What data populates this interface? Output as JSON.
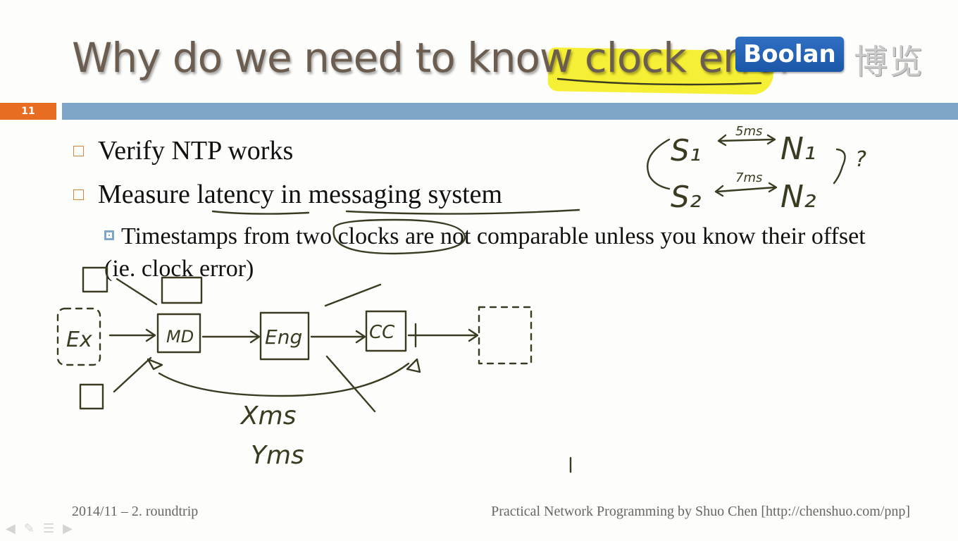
{
  "slide": {
    "title": "Why do we need to know clock error",
    "number": "11",
    "logo_text": "Boolan",
    "logo_cn": "博览"
  },
  "bullets": [
    "Verify NTP works",
    "Measure latency in messaging system"
  ],
  "sub_bullets": [
    "Timestamps from two clocks are not comparable unless you know their offset (ie. clock error)"
  ],
  "footer": {
    "left": "2014/11 – 2. roundtrip",
    "right": "Practical Network Programming by Shuo Chen [http://chenshuo.com/pnp]"
  },
  "annotations": {
    "s1": "S₁",
    "s2": "S₂",
    "n1": "N₁",
    "n2": "N₂",
    "t1": "5ms",
    "t2": "7ms",
    "q": "?",
    "exch": "Ex",
    "md": "MD",
    "eng": "Eng",
    "cc": "CC",
    "x": "Xms",
    "y": "Yms"
  },
  "colors": {
    "accent": "#e86c21",
    "bar": "#7fa6c8",
    "highlight": "#f4ee2a",
    "logo": "#1b57a8"
  }
}
